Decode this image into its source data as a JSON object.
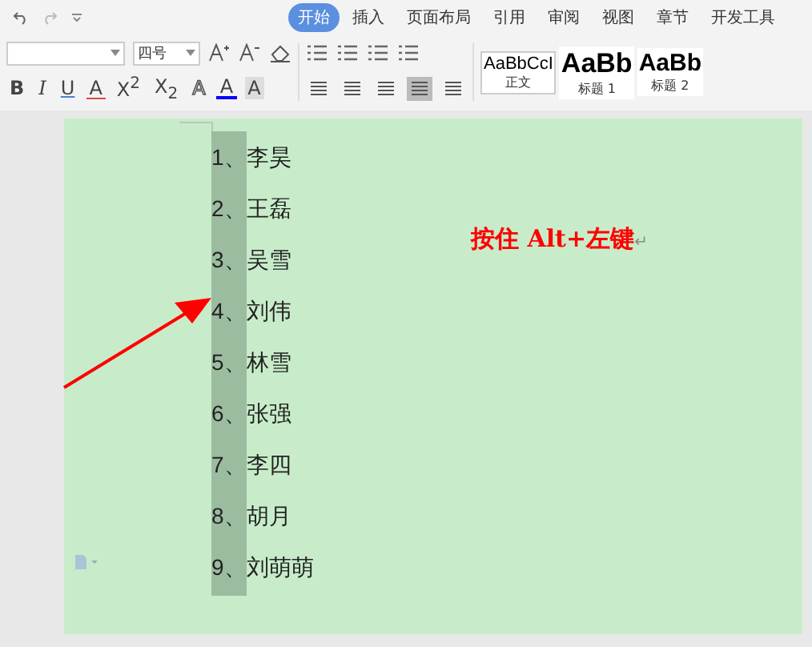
{
  "tabs": [
    {
      "label": "开始",
      "selected": true
    },
    {
      "label": "插入",
      "selected": false
    },
    {
      "label": "页面布局",
      "selected": false
    },
    {
      "label": "引用",
      "selected": false
    },
    {
      "label": "审阅",
      "selected": false
    },
    {
      "label": "视图",
      "selected": false
    },
    {
      "label": "章节",
      "selected": false
    },
    {
      "label": "开发工具",
      "selected": false
    }
  ],
  "font_size": "四号",
  "format_buttons": [
    {
      "label": "B",
      "kind": "bold"
    },
    {
      "label": "I",
      "kind": "italic"
    },
    {
      "label": "U",
      "kind": "underline"
    },
    {
      "label": "A",
      "kind": "strike"
    },
    {
      "label": "X$^{2}$",
      "kind": "plain"
    },
    {
      "label": "X$_{2}$",
      "kind": "plain"
    },
    {
      "label": "A",
      "kind": "outline"
    },
    {
      "label": "A",
      "kind": "fontcolor"
    },
    {
      "label": "A",
      "kind": "shade"
    }
  ],
  "alignments": [
    {
      "selected": false
    },
    {
      "selected": false
    },
    {
      "selected": false
    },
    {
      "selected": true
    },
    {
      "selected": false
    }
  ],
  "styles": [
    {
      "sample": "AaBbCcI",
      "name": "正文",
      "kind": "body"
    },
    {
      "sample": "AaBb",
      "name": "标题 1",
      "kind": "h1"
    },
    {
      "sample": "AaBb",
      "name": "标题 2",
      "kind": "h2"
    }
  ],
  "list": [
    {
      "number": "1、",
      "name": "李昊"
    },
    {
      "number": "2、",
      "name": "王磊"
    },
    {
      "number": "3、",
      "name": "吴雪"
    },
    {
      "number": "4、",
      "name": "刘伟"
    },
    {
      "number": "5、",
      "name": "林雪"
    },
    {
      "number": "6、",
      "name": "张强"
    },
    {
      "number": "7、",
      "name": "李四"
    },
    {
      "number": "8、",
      "name": "胡月"
    },
    {
      "number": "9、",
      "name": "刘萌萌"
    }
  ],
  "annotation": {
    "text": "按住 Alt+左键",
    "mark": "↵"
  }
}
